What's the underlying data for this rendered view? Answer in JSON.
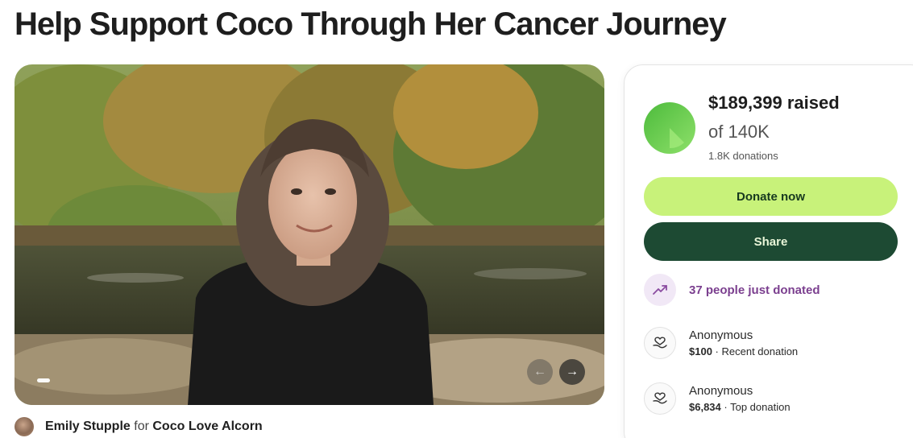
{
  "campaign": {
    "title": "Help Support Coco Through Her Cancer Journey"
  },
  "organizer": {
    "name": "Emily Stupple",
    "connector": "for",
    "beneficiary": "Coco Love Alcorn"
  },
  "gallery": {
    "prev_icon": "arrow-left-icon",
    "next_icon": "arrow-right-icon",
    "prev_glyph": "←",
    "next_glyph": "→"
  },
  "stats": {
    "raised": "$189,399 raised",
    "goal": "of 140K",
    "donations": "1.8K donations",
    "progress_fraction": 1.0,
    "ring_color": "#5cc443"
  },
  "actions": {
    "donate_label": "Donate now",
    "share_label": "Share"
  },
  "activity": {
    "recent_count": "37 people just donated"
  },
  "donations": [
    {
      "name": "Anonymous",
      "amount": "$100",
      "type": "Recent donation"
    },
    {
      "name": "Anonymous",
      "amount": "$6,834",
      "type": "Top donation"
    }
  ],
  "colors": {
    "donate_bg": "#c8f27a",
    "share_bg": "#1d4a33",
    "accent_purple": "#7b3f8f"
  }
}
